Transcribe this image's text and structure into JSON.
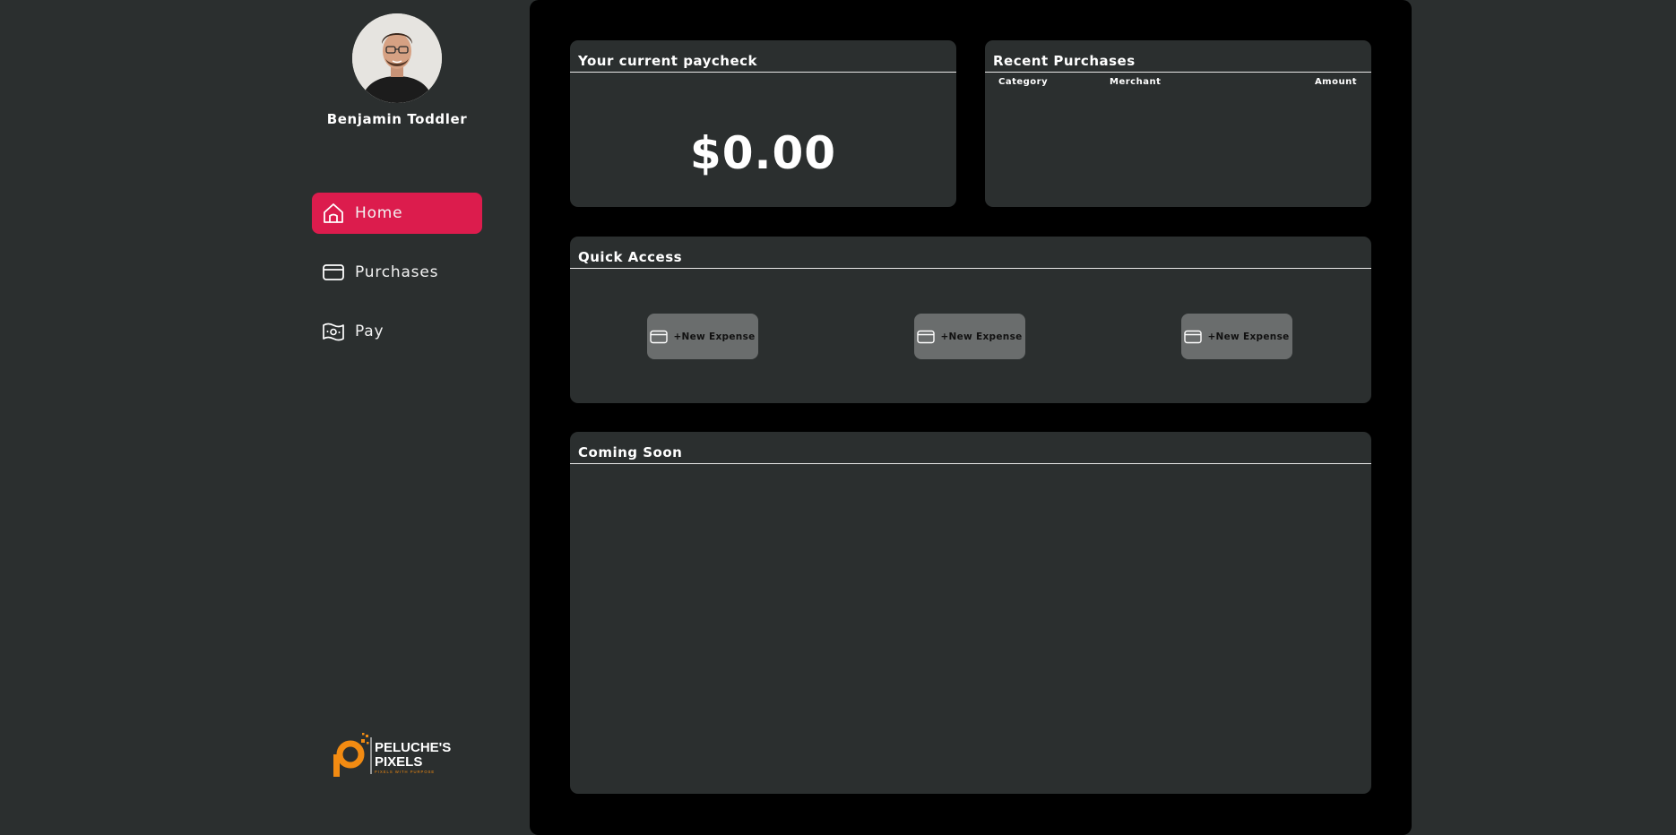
{
  "user": {
    "name": "Benjamin Toddler"
  },
  "nav": {
    "items": [
      {
        "label": "Home",
        "icon": "home-icon",
        "active": true
      },
      {
        "label": "Purchases",
        "icon": "credit-card-icon",
        "active": false
      },
      {
        "label": "Pay",
        "icon": "money-map-icon",
        "active": false
      }
    ]
  },
  "brand": {
    "name_line1": "PELUCHE'S",
    "name_line2": "PIXELS",
    "tagline": "PIXELS WITH PURPOSE"
  },
  "paycheck": {
    "title": "Your current paycheck",
    "amount": "$0.00"
  },
  "recent_purchases": {
    "title": "Recent Purchases",
    "columns": [
      "Category",
      "Merchant",
      "Amount"
    ],
    "rows": []
  },
  "quick_access": {
    "title": "Quick Access",
    "buttons": [
      {
        "label": "+New Expense",
        "icon": "credit-card-icon"
      },
      {
        "label": "+New Expense",
        "icon": "credit-card-icon"
      },
      {
        "label": "+New Expense",
        "icon": "credit-card-icon"
      }
    ]
  },
  "coming_soon": {
    "title": "Coming Soon"
  },
  "colors": {
    "accent": "#dc1c4d",
    "panel": "#2b2f2f",
    "background": "#000000",
    "brand_orange": "#f28b12"
  }
}
